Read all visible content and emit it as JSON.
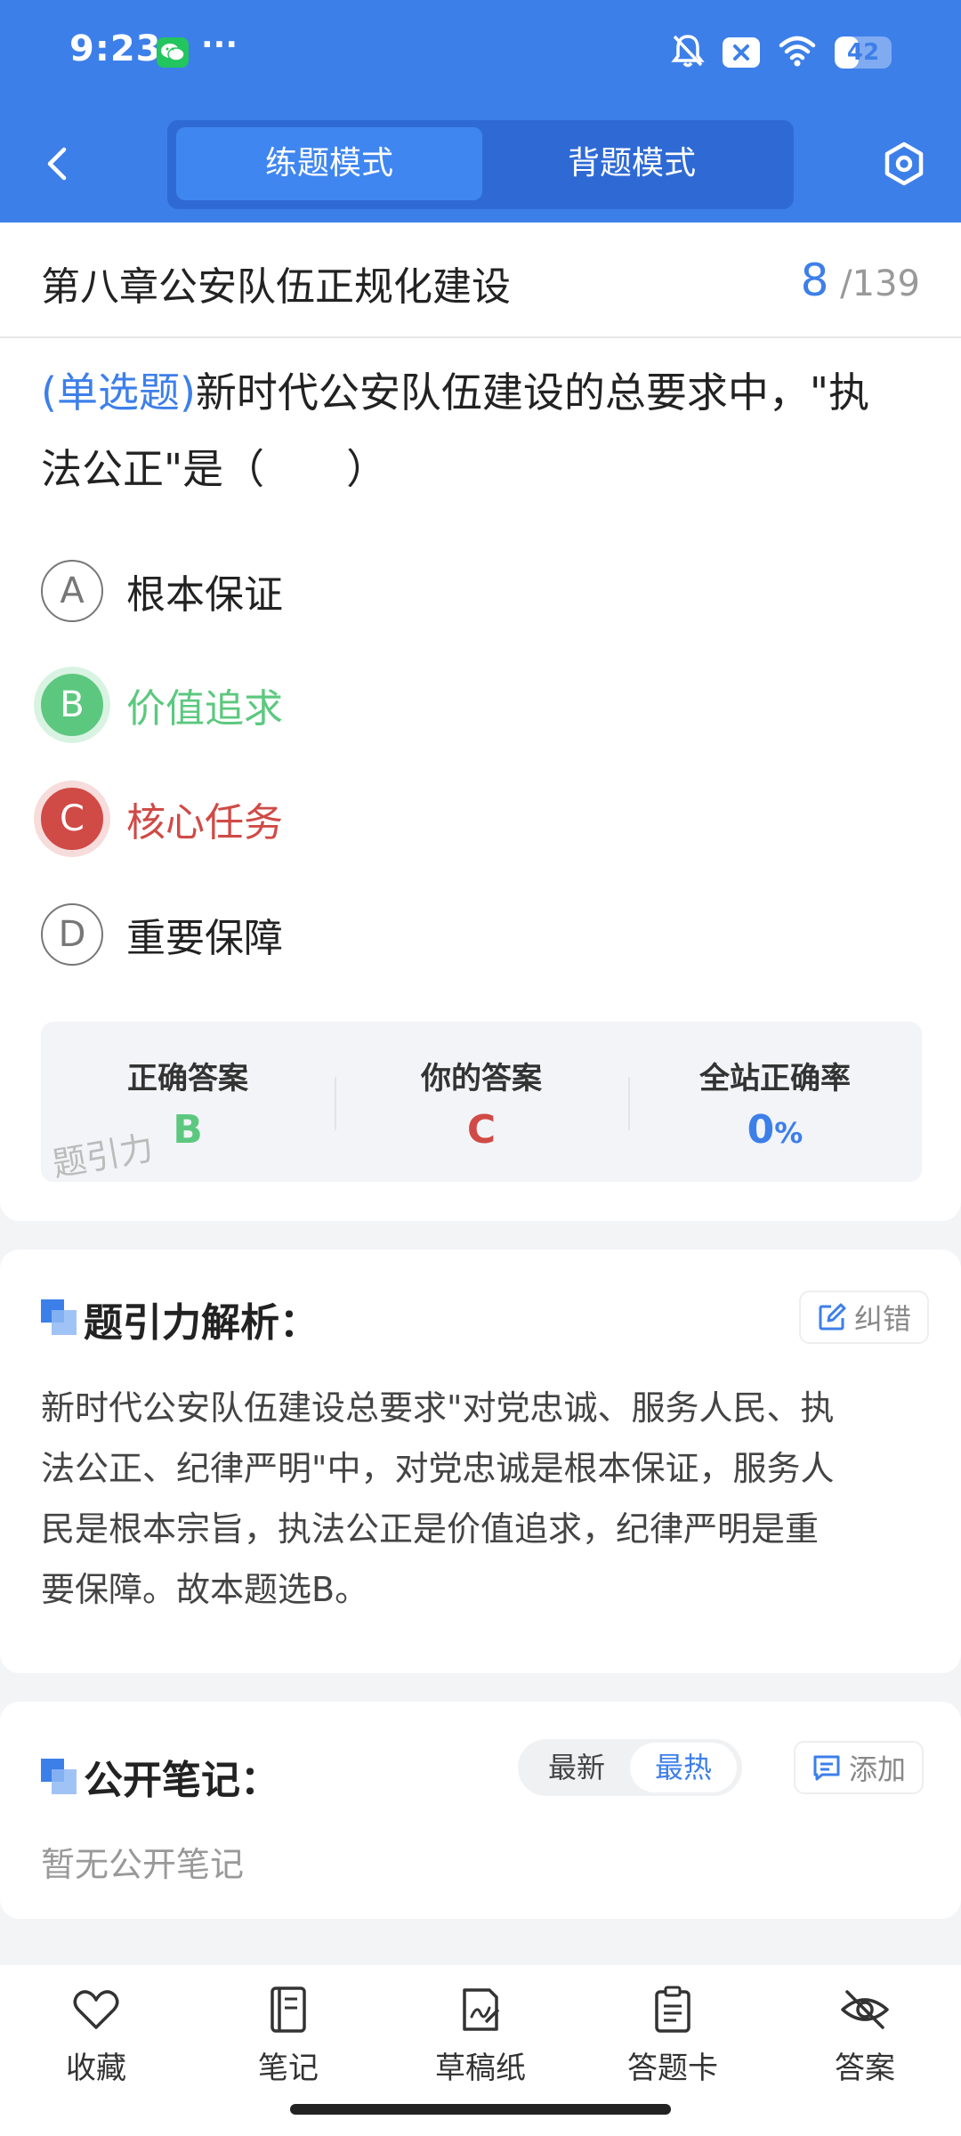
{
  "status": {
    "time": "9:23",
    "more": "···",
    "battery": "42",
    "battery_level": 0.42
  },
  "nav": {
    "mode_practice": "练题模式",
    "mode_memorize": "背题模式"
  },
  "question": {
    "chapter": "第八章公安队伍正规化建设",
    "current": "8",
    "separator": "/",
    "total": "139",
    "type": "(单选题)",
    "text_line1": "新时代公安队伍建设的总要求中，\"执",
    "text_line2": "法公正\"是（　　）",
    "options": [
      {
        "letter": "A",
        "text": "根本保证",
        "state": "normal"
      },
      {
        "letter": "B",
        "text": "价值追求",
        "state": "correct"
      },
      {
        "letter": "C",
        "text": "核心任务",
        "state": "wrong"
      },
      {
        "letter": "D",
        "text": "重要保障",
        "state": "normal"
      }
    ]
  },
  "answer_summary": {
    "correct_label": "正确答案",
    "correct_value": "B",
    "yours_label": "你的答案",
    "yours_value": "C",
    "rate_label": "全站正确率",
    "rate_value": "0",
    "rate_unit": "%",
    "watermark": "题引力",
    "colors": {
      "correct": "#5cc87f",
      "wrong": "#d04a46",
      "accent": "#3d7fe9"
    }
  },
  "analysis": {
    "title": "题引力解析：",
    "correct_button": "纠错",
    "lines": [
      "新时代公安队伍建设总要求\"对党忠诚、服务人民、执",
      "法公正、纪律严明\"中，对党忠诚是根本保证，服务人",
      "民是根本宗旨，执法公正是价值追求，纪律严明是重",
      "要保障。故本题选B。"
    ]
  },
  "notes": {
    "title": "公开笔记：",
    "sort_latest": "最新",
    "sort_hot": "最热",
    "add_button": "添加",
    "empty": "暂无公开笔记"
  },
  "bottom_bar": {
    "favorite": "收藏",
    "notes": "笔记",
    "scratch": "草稿纸",
    "answer_card": "答题卡",
    "answer": "答案"
  },
  "theme": {
    "primary": "#3d7fe9",
    "header_dark": "#2f6ad4"
  }
}
